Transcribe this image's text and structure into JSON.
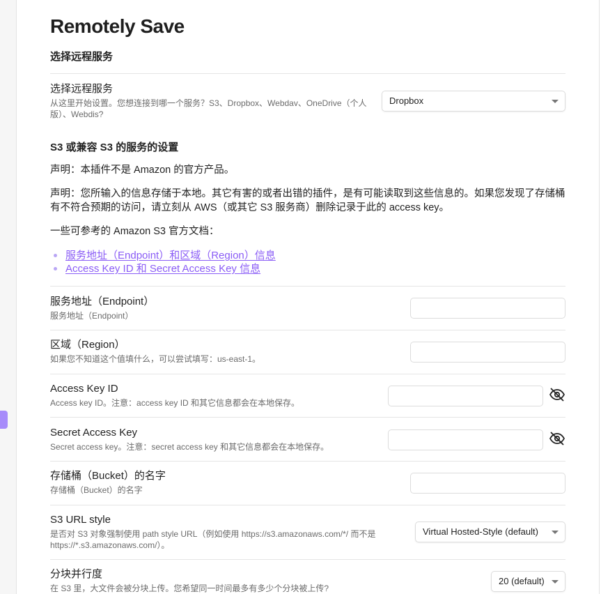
{
  "plugin_title": "Remotely Save",
  "section_choose": {
    "heading": "选择远程服务",
    "setting": {
      "name": "选择远程服务",
      "desc": "从这里开始设置。您想连接到哪一个服务？S3、Dropbox、Webdav、OneDrive（个人版）、Webdis?",
      "value": "Dropbox"
    }
  },
  "section_s3": {
    "heading": "S3 或兼容 S3 的服务的设置",
    "disclaimer1": "声明：本插件不是 Amazon 的官方产品。",
    "disclaimer2": "声明：您所输入的信息存储于本地。其它有害的或者出错的插件，是有可能读取到这些信息的。如果您发现了存储桶有不符合预期的访问，请立刻从 AWS（或其它 S3 服务商）删除记录于此的 access key。",
    "docs_intro": "一些可参考的 Amazon S3 官方文档：",
    "links": [
      "服务地址（Endpoint）和区域（Region）信息",
      "Access Key ID 和 Secret Access Key 信息"
    ]
  },
  "settings": {
    "endpoint": {
      "name": "服务地址（Endpoint）",
      "desc": "服务地址（Endpoint）",
      "value": ""
    },
    "region": {
      "name": "区域（Region）",
      "desc": "如果您不知道这个值填什么，可以尝试填写：us-east-1。",
      "value": ""
    },
    "access_key": {
      "name": "Access Key ID",
      "desc": "Access key ID。注意：access key ID 和其它信息都会在本地保存。",
      "value": "",
      "icon": "eye-off-icon"
    },
    "secret_key": {
      "name": "Secret Access Key",
      "desc": "Secret access key。注意：secret access key 和其它信息都会在本地保存。",
      "value": "",
      "icon": "eye-off-icon"
    },
    "bucket": {
      "name": "存储桶（Bucket）的名字",
      "desc": "存储桶（Bucket）的名字",
      "value": ""
    },
    "url_style": {
      "name": "S3 URL style",
      "desc": "是否对 S3 对象强制使用 path style URL（例如使用 https://s3.amazonaws.com/*/ 而不是 https://*.s3.amazonaws.com/）。",
      "value": "Virtual Hosted-Style (default)"
    },
    "parallelism": {
      "name": "分块并行度",
      "desc": "在 S3 里，大文件会被分块上传。您希望同一时间最多有多少个分块被上传?",
      "value": "20 (default)"
    }
  },
  "colors": {
    "accent": "#8a5cf6",
    "rail_tab": "#a78bfa"
  }
}
